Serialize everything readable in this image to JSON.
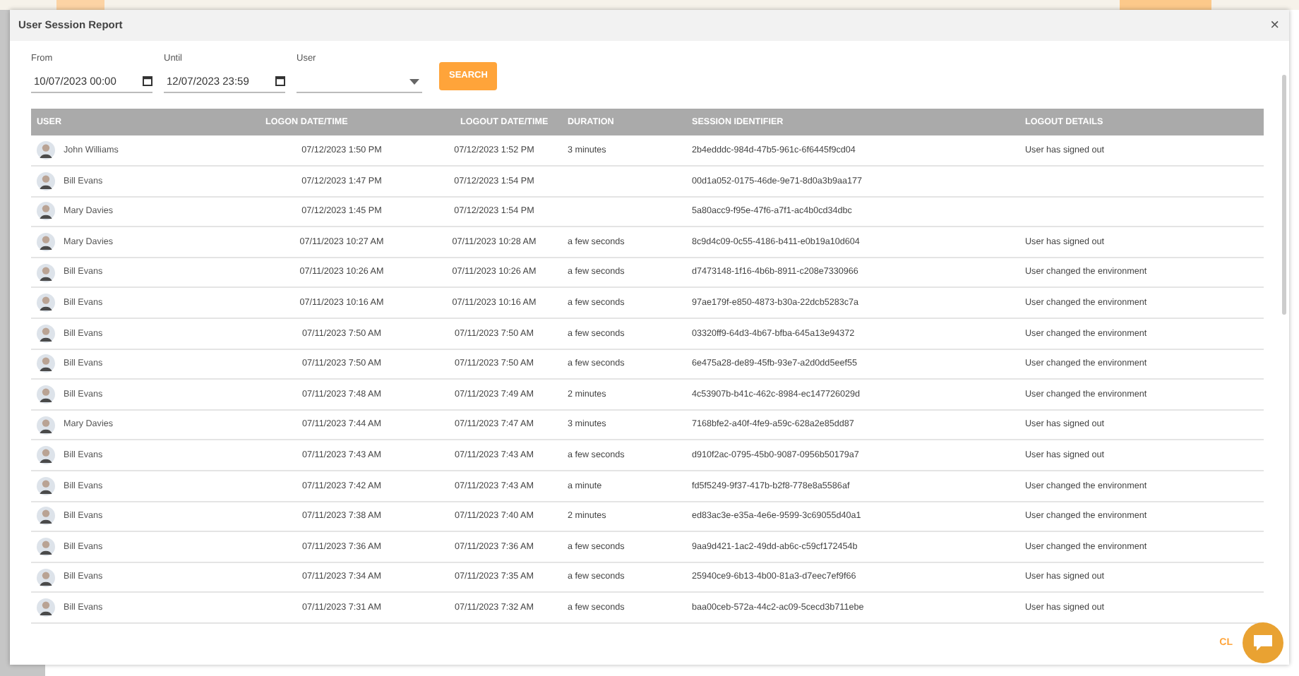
{
  "dialog": {
    "title": "User Session Report",
    "close_label": "×"
  },
  "filters": {
    "from": {
      "label": "From",
      "value": "10/07/2023 00:00"
    },
    "until": {
      "label": "Until",
      "value": "12/07/2023 23:59"
    },
    "user": {
      "label": "User"
    },
    "search_button": "SEARCH"
  },
  "table": {
    "columns": [
      "USER",
      "LOGON DATE/TIME",
      "LOGOUT DATE/TIME",
      "DURATION",
      "SESSION IDENTIFIER",
      "LOGOUT DETAILS"
    ],
    "rows": [
      {
        "user": "John Williams",
        "logon": "07/12/2023 1:50 PM",
        "logout": "07/12/2023 1:52 PM",
        "duration": "3 minutes",
        "session": "2b4edddc-984d-47b5-961c-6f6445f9cd04",
        "details": "User has signed out"
      },
      {
        "user": "Bill Evans",
        "logon": "07/12/2023 1:47 PM",
        "logout": "07/12/2023 1:54 PM",
        "session": "00d1a052-0175-46de-9e71-8d0a3b9aa177"
      },
      {
        "user": "Mary Davies",
        "logon": "07/12/2023 1:45 PM",
        "logout": "07/12/2023 1:54 PM",
        "session": "5a80acc9-f95e-47f6-a7f1-ac4b0cd34dbc"
      },
      {
        "user": "Mary Davies",
        "logon": "07/11/2023 10:27 AM",
        "logout": "07/11/2023 10:28 AM",
        "duration": "a few seconds",
        "session": "8c9d4c09-0c55-4186-b411-e0b19a10d604",
        "details": "User has signed out"
      },
      {
        "user": "Bill Evans",
        "logon": "07/11/2023 10:26 AM",
        "logout": "07/11/2023 10:26 AM",
        "duration": "a few seconds",
        "session": "d7473148-1f16-4b6b-8911-c208e7330966",
        "details": "User changed the environment"
      },
      {
        "user": "Bill Evans",
        "logon": "07/11/2023 10:16 AM",
        "logout": "07/11/2023 10:16 AM",
        "duration": "a few seconds",
        "session": "97ae179f-e850-4873-b30a-22dcb5283c7a",
        "details": "User changed the environment"
      },
      {
        "user": "Bill Evans",
        "logon": "07/11/2023 7:50 AM",
        "logout": "07/11/2023 7:50 AM",
        "duration": "a few seconds",
        "session": "03320ff9-64d3-4b67-bfba-645a13e94372",
        "details": "User changed the environment"
      },
      {
        "user": "Bill Evans",
        "logon": "07/11/2023 7:50 AM",
        "logout": "07/11/2023 7:50 AM",
        "duration": "a few seconds",
        "session": "6e475a28-de89-45fb-93e7-a2d0dd5eef55",
        "details": "User changed the environment"
      },
      {
        "user": "Bill Evans",
        "logon": "07/11/2023 7:48 AM",
        "logout": "07/11/2023 7:49 AM",
        "duration": "2 minutes",
        "session": "4c53907b-b41c-462c-8984-ec147726029d",
        "details": "User changed the environment"
      },
      {
        "user": "Mary Davies",
        "logon": "07/11/2023 7:44 AM",
        "logout": "07/11/2023 7:47 AM",
        "duration": "3 minutes",
        "session": "7168bfe2-a40f-4fe9-a59c-628a2e85dd87",
        "details": "User has signed out"
      },
      {
        "user": "Bill Evans",
        "logon": "07/11/2023 7:43 AM",
        "logout": "07/11/2023 7:43 AM",
        "duration": "a few seconds",
        "session": "d910f2ac-0795-45b0-9087-0956b50179a7",
        "details": "User has signed out"
      },
      {
        "user": "Bill Evans",
        "logon": "07/11/2023 7:42 AM",
        "logout": "07/11/2023 7:43 AM",
        "duration": "a minute",
        "session": "fd5f5249-9f37-417b-b2f8-778e8a5586af",
        "details": "User changed the environment"
      },
      {
        "user": "Bill Evans",
        "logon": "07/11/2023 7:38 AM",
        "logout": "07/11/2023 7:40 AM",
        "duration": "2 minutes",
        "session": "ed83ac3e-e35a-4e6e-9599-3c69055d40a1",
        "details": "User changed the environment"
      },
      {
        "user": "Bill Evans",
        "logon": "07/11/2023 7:36 AM",
        "logout": "07/11/2023 7:36 AM",
        "duration": "a few seconds",
        "session": "9aa9d421-1ac2-49dd-ab6c-c59cf172454b",
        "details": "User changed the environment"
      },
      {
        "user": "Bill Evans",
        "logon": "07/11/2023 7:34 AM",
        "logout": "07/11/2023 7:35 AM",
        "duration": "a few seconds",
        "session": "25940ce9-6b13-4b00-81a3-d7eec7ef9f66",
        "details": "User has signed out"
      },
      {
        "user": "Bill Evans",
        "logon": "07/11/2023 7:31 AM",
        "logout": "07/11/2023 7:32 AM",
        "duration": "a few seconds",
        "session": "baa00ceb-572a-44c2-ac09-5cecd3b711ebe",
        "details": "User has signed out"
      }
    ]
  },
  "footer": {
    "close_button": "CL"
  }
}
